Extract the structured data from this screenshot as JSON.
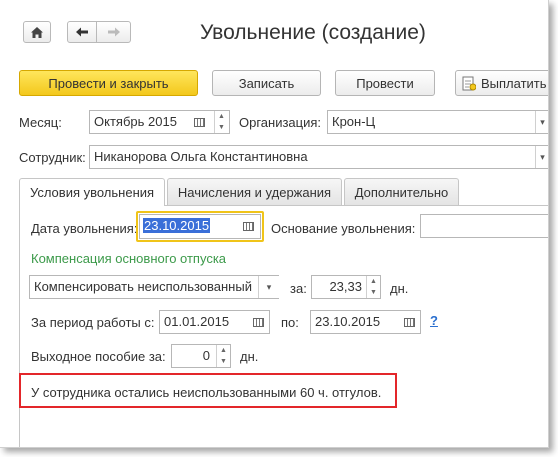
{
  "window": {
    "title": "Увольнение (создание)"
  },
  "nav": {
    "home_icon": "home-icon",
    "back_icon": "arrow-left-icon",
    "forward_icon": "arrow-right-icon"
  },
  "toolbar": {
    "post_and_close": "Провести и закрыть",
    "save": "Записать",
    "post": "Провести",
    "pay": "Выплатить"
  },
  "header_fields": {
    "month_label": "Месяц:",
    "month_value": "Октябрь 2015",
    "org_label": "Организация:",
    "org_value": "Крон-Ц",
    "employee_label": "Сотрудник:",
    "employee_value": "Никанорова Ольга Константиновна"
  },
  "tabs": [
    {
      "label": "Условия увольнения",
      "active": true
    },
    {
      "label": "Начисления и удержания",
      "active": false
    },
    {
      "label": "Дополнительно",
      "active": false
    }
  ],
  "conditions": {
    "dismissal_date_label": "Дата увольнения:",
    "dismissal_date_value": "23.10.2015",
    "basis_label": "Основание увольнения:",
    "basis_value": "",
    "compensation_section": "Компенсация основного отпуска",
    "compensation_mode": "Компенсировать неиспользованный",
    "for_label": "за:",
    "days_value": "23,33",
    "days_unit": "дн.",
    "period_label": "За период работы с:",
    "period_from": "01.01.2015",
    "period_to_label": "по:",
    "period_to": "23.10.2015",
    "help": "?",
    "severance_label": "Выходное пособие за:",
    "severance_value": "0",
    "severance_unit": "дн.",
    "info_message": "У сотрудника остались неиспользованными 60 ч. отгулов."
  },
  "colors": {
    "accent_yellow": "#f5cc1e",
    "section_green": "#3c9a4a",
    "highlight_red": "#e3262a",
    "date_selection": "#3a6fd8"
  }
}
